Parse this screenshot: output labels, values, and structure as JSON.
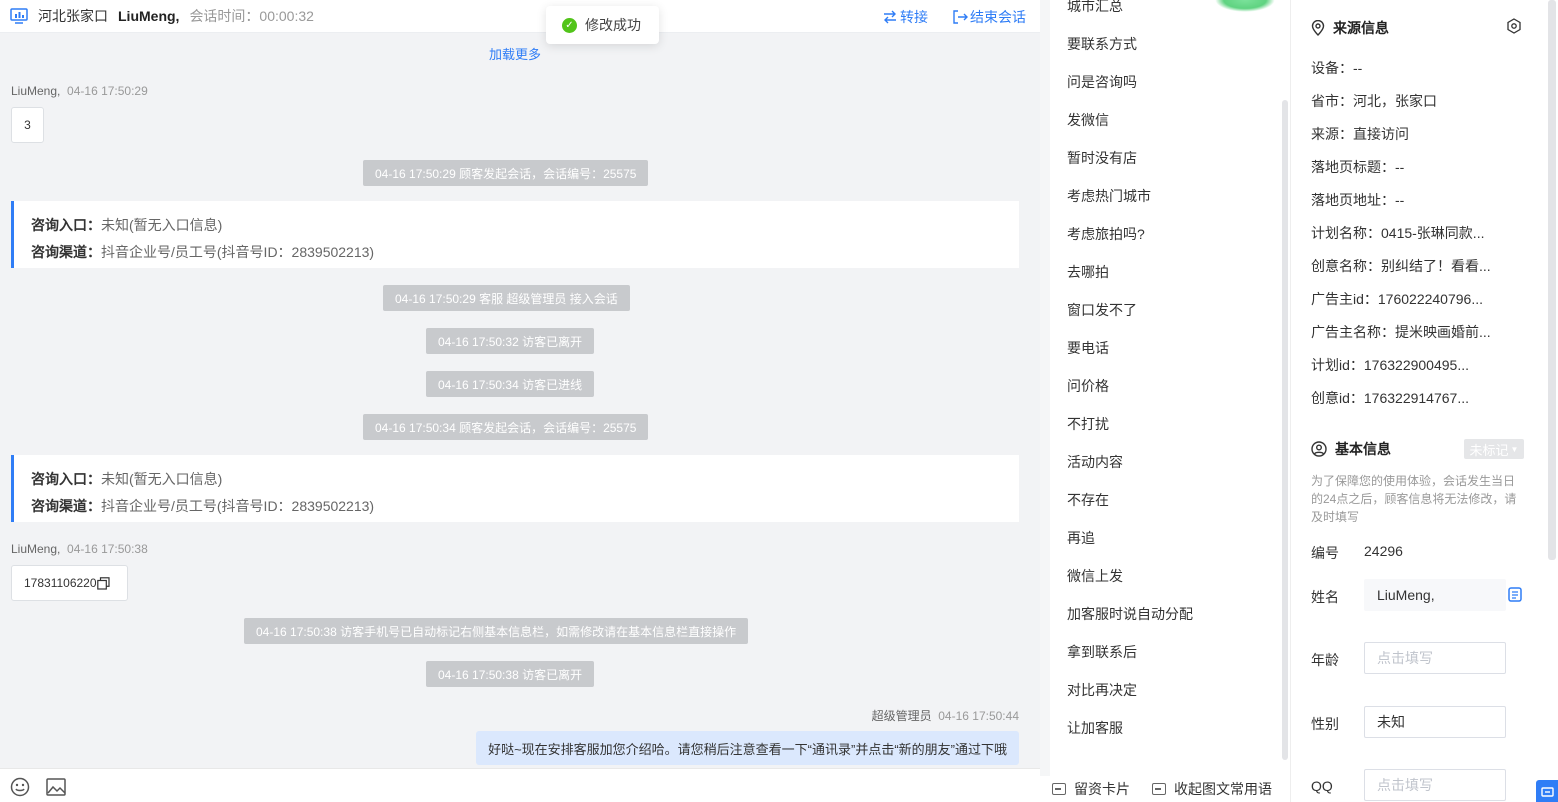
{
  "header": {
    "location": "河北张家口",
    "visitor_name": "LiuMeng,",
    "session_time": "会话时间：00:00:32",
    "transfer": "转接",
    "end_session": "结束会话"
  },
  "toast": {
    "message": "修改成功"
  },
  "chat": {
    "load_more": "加载更多",
    "msg1": {
      "name": "LiuMeng,",
      "time": "04-16 17:50:29",
      "text": "3"
    },
    "sys1": "04-16 17:50:29 顾客发起会话，会话编号：25575",
    "card1": {
      "entry_label": "咨询入口：",
      "entry_value": "未知(暂无入口信息)",
      "channel_label": "咨询渠道：",
      "channel_value": "抖音企业号/员工号(抖音号ID：2839502213)"
    },
    "sys2": "04-16 17:50:29 客服 超级管理员 接入会话",
    "sys3": "04-16 17:50:32 访客已离开",
    "sys4": "04-16 17:50:34 访客已进线",
    "sys5": "04-16 17:50:34 顾客发起会话，会话编号：25575",
    "card2": {
      "entry_label": "咨询入口：",
      "entry_value": "未知(暂无入口信息)",
      "channel_label": "咨询渠道：",
      "channel_value": "抖音企业号/员工号(抖音号ID：2839502213)"
    },
    "msg2": {
      "name": "LiuMeng,",
      "time": "04-16 17:50:38",
      "text": "17831106220"
    },
    "sys6": "04-16 17:50:38 访客手机号已自动标记右侧基本信息栏，如需修改请在基本信息栏直接操作",
    "sys7": "04-16 17:50:38 访客已离开",
    "msg3": {
      "name": "超级管理员",
      "time": "04-16 17:50:44",
      "text": "好哒~现在安排客服加您介绍哈。请您稍后注意查看一下“通讯录”并点击“新的朋友”通过下哦"
    }
  },
  "quick_replies": [
    "城市汇总",
    "要联系方式",
    "问是咨询吗",
    "发微信",
    "暂时没有店",
    "考虑热门城市",
    "考虑旅拍吗?",
    "去哪拍",
    "窗口发不了",
    "要电话",
    "问价格",
    "不打扰",
    "活动内容",
    "不存在",
    "再追",
    "微信上发",
    "加客服时说自动分配",
    "拿到联系后",
    "对比再决定",
    "让加客服"
  ],
  "quick_bottom": {
    "card": "留资卡片",
    "collapse": "收起图文常用语"
  },
  "source_info": {
    "title": "来源信息",
    "device": "设备：--",
    "province": "省市：河北，张家口",
    "source": "来源：直接访问",
    "landing_title": "落地页标题：--",
    "landing_url": "落地页地址：--",
    "plan_name": "计划名称：0415-张琳同款...",
    "creative_name": "创意名称：别纠结了！看看...",
    "advertiser_id": "广告主id：176022240796...",
    "advertiser_name": "广告主名称：提米映画婚前...",
    "plan_id": "计划id：176322900495...",
    "creative_id": "创意id：176322914767..."
  },
  "basic_info": {
    "title": "基本信息",
    "tag": "未标记",
    "note": "为了保障您的使用体验，会话发生当日的24点之后，顾客信息将无法修改，请及时填写",
    "id_label": "编号",
    "id_value": "24296",
    "name_label": "姓名",
    "name_value": "LiuMeng,",
    "age_label": "年龄",
    "age_placeholder": "点击填写",
    "gender_label": "性别",
    "gender_value": "未知",
    "qq_label": "QQ",
    "qq_placeholder": "点击填写"
  },
  "colors": {
    "accent": "#2f7df6",
    "success": "#52c41a",
    "system_bubble": "#c8cacd",
    "agent_bubble": "#dbe8fd"
  }
}
